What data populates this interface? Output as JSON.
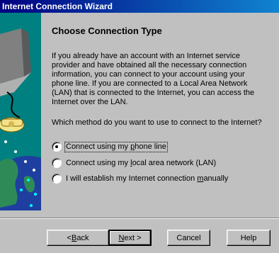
{
  "window": {
    "title": "Internet Connection Wizard"
  },
  "page": {
    "heading": "Choose Connection Type",
    "intro": "If you already have an account with an Internet service provider and have obtained all the necessary connection information, you can connect to your account using your phone line. If you are connected to a Local Area Network (LAN) that is connected to the Internet, you can access the Internet over the LAN.",
    "question": "Which method do you want to use to connect to the Internet?"
  },
  "options": [
    {
      "pre": "Connect using my ",
      "key": "p",
      "post": "hone line",
      "checked": true
    },
    {
      "pre": "Connect using my ",
      "key": "l",
      "post": "ocal area network (LAN)",
      "checked": false
    },
    {
      "pre": "I will establish my Internet connection ",
      "key": "m",
      "post": "anually",
      "checked": false
    }
  ],
  "buttons": {
    "back": {
      "prefix": "< ",
      "key": "B",
      "rest": "ack"
    },
    "next": {
      "key": "N",
      "rest": "ext >"
    },
    "cancel": "Cancel",
    "help": "Help"
  },
  "colors": {
    "title_bar": "#000080",
    "dialog_bg": "#c0c0c0",
    "art_bg": "#008080"
  },
  "icons": [
    "computer-icon",
    "telephone-icon",
    "globe-icon"
  ]
}
